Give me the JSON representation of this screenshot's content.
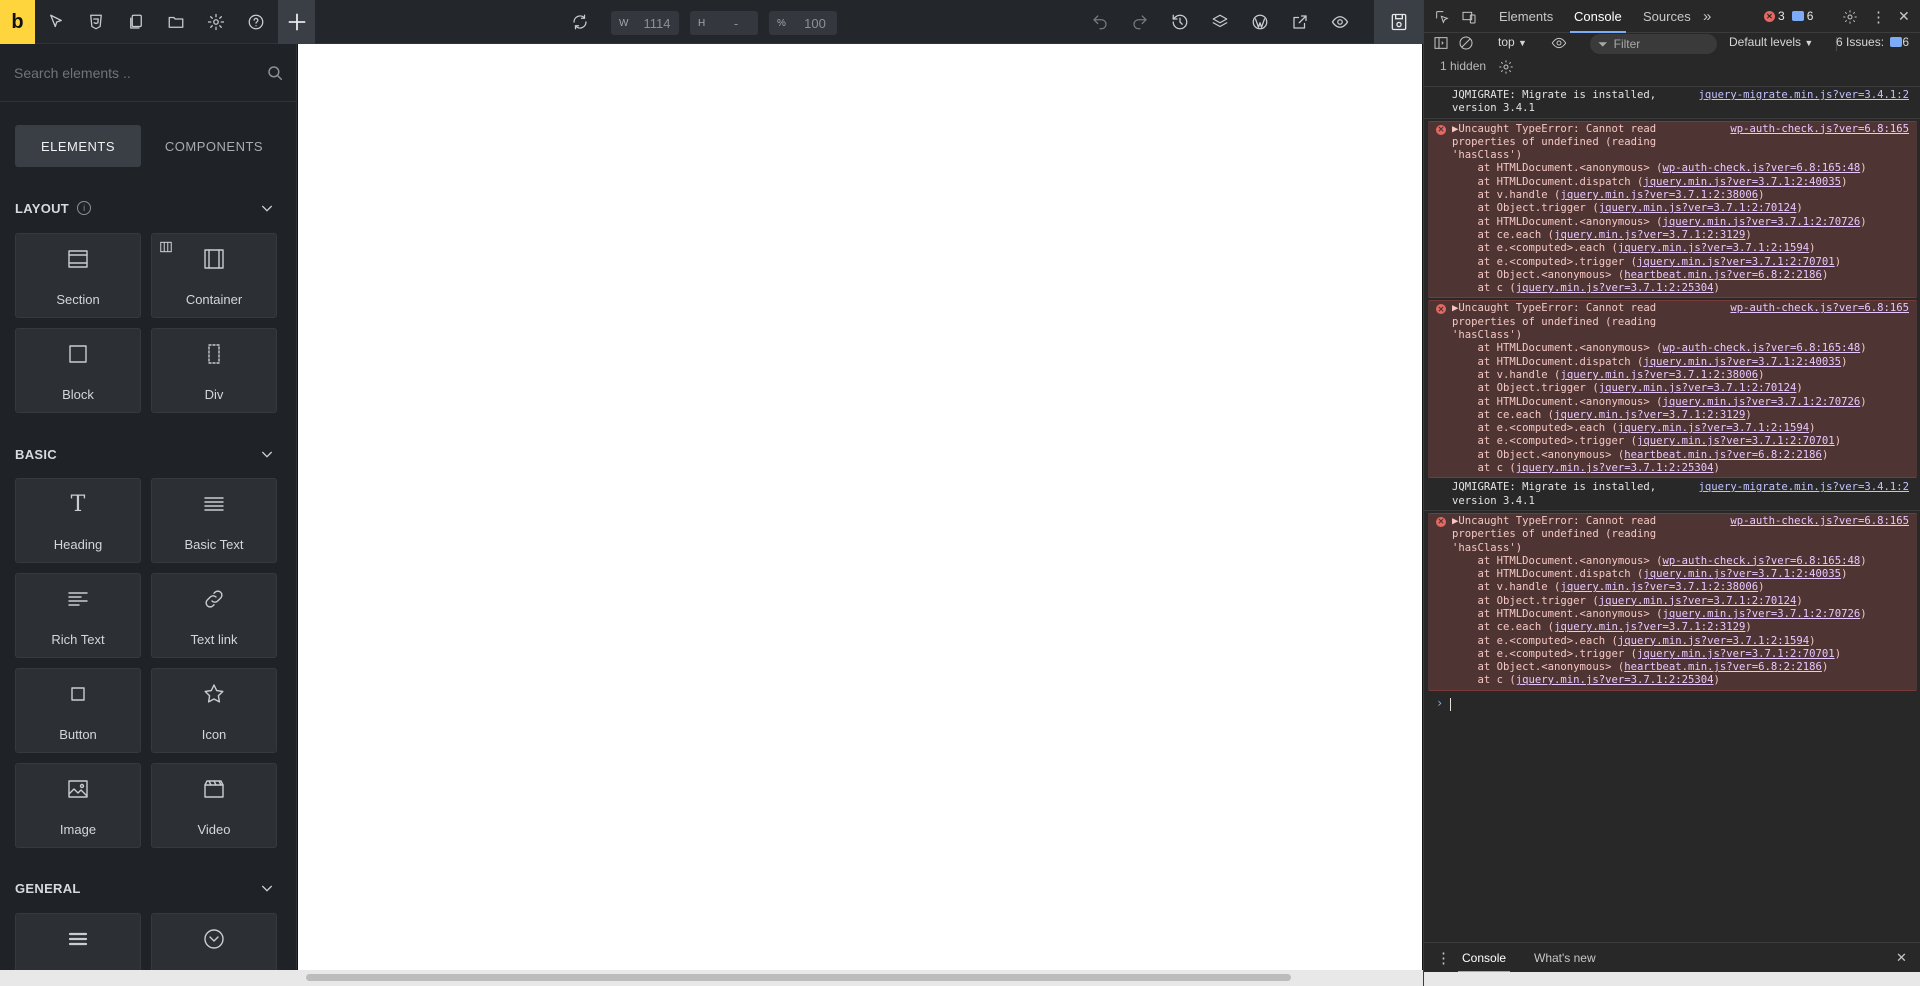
{
  "builder": {
    "logo": "b",
    "dimensions": {
      "width_key": "W",
      "width_value": "1114",
      "height_key": "H",
      "height_value": "-",
      "zoom_key": "%",
      "zoom_value": "100"
    }
  },
  "panel": {
    "search_placeholder": "Search elements ..",
    "tabs": {
      "elements": "ELEMENTS",
      "components": "COMPONENTS"
    },
    "categories": {
      "layout": "LAYOUT",
      "basic": "BASIC",
      "general": "GENERAL"
    },
    "info_glyph": "i",
    "layout_items": [
      "Section",
      "Container",
      "Block",
      "Div"
    ],
    "basic_items": [
      "Heading",
      "Basic Text",
      "Rich Text",
      "Text link",
      "Button",
      "Icon",
      "Image",
      "Video"
    ],
    "heading_glyph": "T"
  },
  "devtools": {
    "tabs": [
      "Elements",
      "Console",
      "Sources"
    ],
    "more": "»",
    "error_count": "3",
    "message_count": "6",
    "context": "top",
    "filter_placeholder": "Filter",
    "levels": "Default levels",
    "issues_label": "6 Issues:",
    "issues_count": "6",
    "hidden": "1 hidden",
    "drawer_tabs": [
      "Console",
      "What's new"
    ],
    "messages": [
      {
        "type": "info",
        "text": "JQMIGRATE: Migrate is installed, version 3.4.1",
        "source": "jquery-migrate.min.js?ver=3.4.1:2"
      },
      {
        "type": "error",
        "text": "▶Uncaught TypeError: Cannot read properties of undefined (reading 'hasClass')",
        "source": "wp-auth-check.js?ver=6.8:165",
        "stack": [
          {
            "pre": "    at HTMLDocument.<anonymous> (",
            "link": "wp-auth-check.js?ver=6.8:165:48",
            "post": ")"
          },
          {
            "pre": "    at HTMLDocument.dispatch (",
            "link": "jquery.min.js?ver=3.7.1:2:40035",
            "post": ")"
          },
          {
            "pre": "    at v.handle (",
            "link": "jquery.min.js?ver=3.7.1:2:38006",
            "post": ")"
          },
          {
            "pre": "    at Object.trigger (",
            "link": "jquery.min.js?ver=3.7.1:2:70124",
            "post": ")"
          },
          {
            "pre": "    at HTMLDocument.<anonymous> (",
            "link": "jquery.min.js?ver=3.7.1:2:70726",
            "post": ")"
          },
          {
            "pre": "    at ce.each (",
            "link": "jquery.min.js?ver=3.7.1:2:3129",
            "post": ")"
          },
          {
            "pre": "    at e.<computed>.each (",
            "link": "jquery.min.js?ver=3.7.1:2:1594",
            "post": ")"
          },
          {
            "pre": "    at e.<computed>.trigger (",
            "link": "jquery.min.js?ver=3.7.1:2:70701",
            "post": ")"
          },
          {
            "pre": "    at Object.<anonymous> (",
            "link": "heartbeat.min.js?ver=6.8:2:2186",
            "post": ")"
          },
          {
            "pre": "    at c (",
            "link": "jquery.min.js?ver=3.7.1:2:25304",
            "post": ")"
          }
        ]
      },
      {
        "type": "error",
        "text": "▶Uncaught TypeError: Cannot read properties of undefined (reading 'hasClass')",
        "source": "wp-auth-check.js?ver=6.8:165",
        "stack": [
          {
            "pre": "    at HTMLDocument.<anonymous> (",
            "link": "wp-auth-check.js?ver=6.8:165:48",
            "post": ")"
          },
          {
            "pre": "    at HTMLDocument.dispatch (",
            "link": "jquery.min.js?ver=3.7.1:2:40035",
            "post": ")"
          },
          {
            "pre": "    at v.handle (",
            "link": "jquery.min.js?ver=3.7.1:2:38006",
            "post": ")"
          },
          {
            "pre": "    at Object.trigger (",
            "link": "jquery.min.js?ver=3.7.1:2:70124",
            "post": ")"
          },
          {
            "pre": "    at HTMLDocument.<anonymous> (",
            "link": "jquery.min.js?ver=3.7.1:2:70726",
            "post": ")"
          },
          {
            "pre": "    at ce.each (",
            "link": "jquery.min.js?ver=3.7.1:2:3129",
            "post": ")"
          },
          {
            "pre": "    at e.<computed>.each (",
            "link": "jquery.min.js?ver=3.7.1:2:1594",
            "post": ")"
          },
          {
            "pre": "    at e.<computed>.trigger (",
            "link": "jquery.min.js?ver=3.7.1:2:70701",
            "post": ")"
          },
          {
            "pre": "    at Object.<anonymous> (",
            "link": "heartbeat.min.js?ver=6.8:2:2186",
            "post": ")"
          },
          {
            "pre": "    at c (",
            "link": "jquery.min.js?ver=3.7.1:2:25304",
            "post": ")"
          }
        ]
      },
      {
        "type": "info",
        "text": "JQMIGRATE: Migrate is installed, version 3.4.1",
        "source": "jquery-migrate.min.js?ver=3.4.1:2"
      },
      {
        "type": "error",
        "text": "▶Uncaught TypeError: Cannot read properties of undefined (reading 'hasClass')",
        "source": "wp-auth-check.js?ver=6.8:165",
        "stack": [
          {
            "pre": "    at HTMLDocument.<anonymous> (",
            "link": "wp-auth-check.js?ver=6.8:165:48",
            "post": ")"
          },
          {
            "pre": "    at HTMLDocument.dispatch (",
            "link": "jquery.min.js?ver=3.7.1:2:40035",
            "post": ")"
          },
          {
            "pre": "    at v.handle (",
            "link": "jquery.min.js?ver=3.7.1:2:38006",
            "post": ")"
          },
          {
            "pre": "    at Object.trigger (",
            "link": "jquery.min.js?ver=3.7.1:2:70124",
            "post": ")"
          },
          {
            "pre": "    at HTMLDocument.<anonymous> (",
            "link": "jquery.min.js?ver=3.7.1:2:70726",
            "post": ")"
          },
          {
            "pre": "    at ce.each (",
            "link": "jquery.min.js?ver=3.7.1:2:3129",
            "post": ")"
          },
          {
            "pre": "    at e.<computed>.each (",
            "link": "jquery.min.js?ver=3.7.1:2:1594",
            "post": ")"
          },
          {
            "pre": "    at e.<computed>.trigger (",
            "link": "jquery.min.js?ver=3.7.1:2:70701",
            "post": ")"
          },
          {
            "pre": "    at Object.<anonymous> (",
            "link": "heartbeat.min.js?ver=6.8:2:2186",
            "post": ")"
          },
          {
            "pre": "    at c (",
            "link": "jquery.min.js?ver=3.7.1:2:25304",
            "post": ")"
          }
        ]
      }
    ],
    "prompt": "›"
  }
}
